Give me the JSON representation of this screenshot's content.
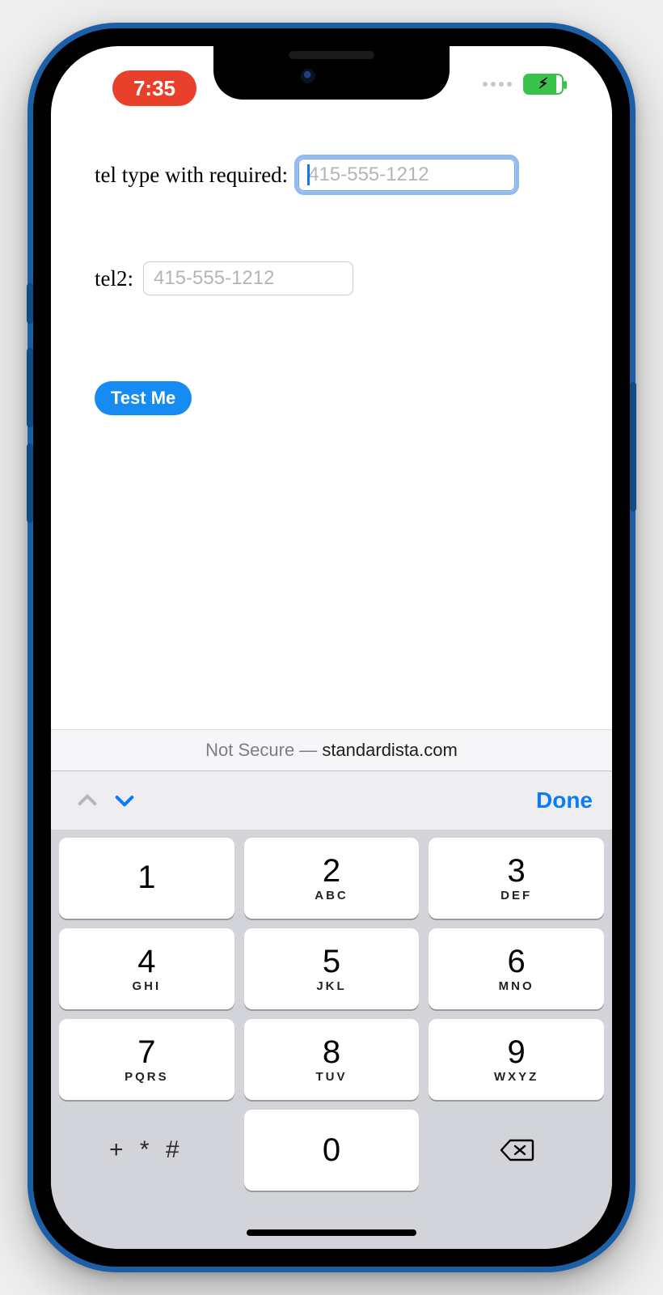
{
  "statusbar": {
    "time": "7:35"
  },
  "form": {
    "tel1_label": "tel type with required:",
    "tel1_placeholder": "415-555-1212",
    "tel2_label": "tel2:",
    "tel2_placeholder": "415-555-1212",
    "test_button": "Test Me"
  },
  "urlbar": {
    "prefix": "Not Secure —",
    "domain": "standardista.com"
  },
  "accessory": {
    "done": "Done"
  },
  "keypad": {
    "keys": [
      {
        "digit": "1",
        "letters": ""
      },
      {
        "digit": "2",
        "letters": "ABC"
      },
      {
        "digit": "3",
        "letters": "DEF"
      },
      {
        "digit": "4",
        "letters": "GHI"
      },
      {
        "digit": "5",
        "letters": "JKL"
      },
      {
        "digit": "6",
        "letters": "MNO"
      },
      {
        "digit": "7",
        "letters": "PQRS"
      },
      {
        "digit": "8",
        "letters": "TUV"
      },
      {
        "digit": "9",
        "letters": "WXYZ"
      }
    ],
    "symbols": "+ * #",
    "zero": "0"
  }
}
